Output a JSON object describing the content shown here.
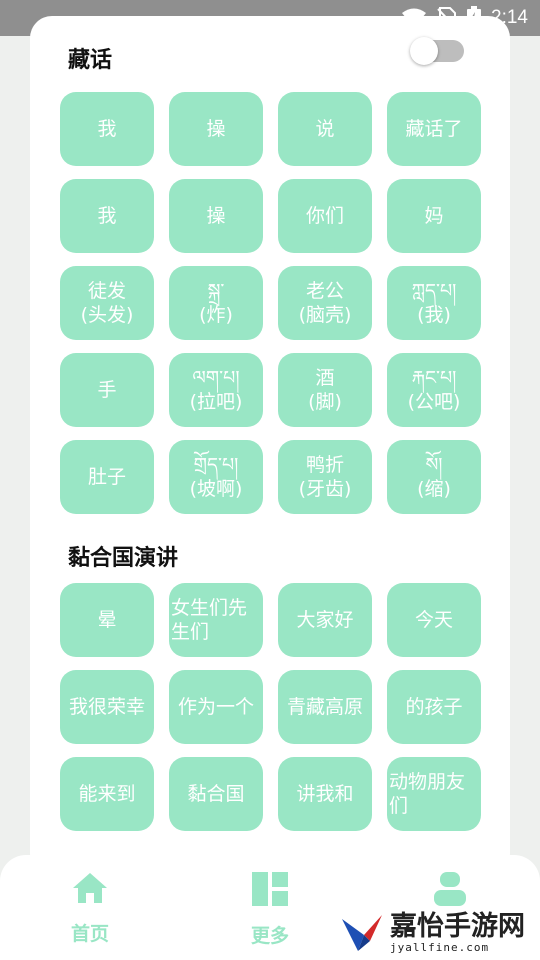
{
  "status_bar": {
    "time": "2:14",
    "icons": [
      "wifi-icon",
      "no-sim-icon",
      "battery-charging-icon"
    ]
  },
  "section1": {
    "title": "藏话",
    "toggle": {
      "on": false
    },
    "tiles": [
      "我",
      "操",
      "说",
      "藏话了",
      "我",
      "操",
      "你们",
      "妈",
      "徒发\n(头发)",
      "སྐྲ་\n(炸)",
      "老公\n(脑壳)",
      "ཀླད་པ།\n(我)",
      "手",
      "ལག་པ།\n(拉吧)",
      "酒\n(脚)",
      "རྐང་པ།\n(公吧)",
      "肚子",
      "གྲོད་པ།\n(坡啊)",
      "鸭折\n(牙齿)",
      "སོ།\n(缩)"
    ]
  },
  "section2": {
    "title": "黏合国演讲",
    "tiles": [
      "晕",
      "女生们先\n生们",
      "大家好",
      "今天",
      "我很荣幸",
      "作为一个",
      "青藏高原",
      "的孩子",
      "能来到",
      "黏合国",
      "讲我和",
      "动物朋友\n们"
    ]
  },
  "bottom_nav": {
    "items": [
      {
        "label": "首页",
        "icon": "home-icon"
      },
      {
        "label": "更多",
        "icon": "dashboard-icon"
      },
      {
        "label": "",
        "icon": "profile-icon"
      }
    ]
  },
  "watermark": {
    "title": "嘉怡手游网",
    "url": "jyallfine.com"
  },
  "colors": {
    "accent": "#99e6c5",
    "tile_text": "#ffffff",
    "status_bar": "#8f8f8f"
  }
}
